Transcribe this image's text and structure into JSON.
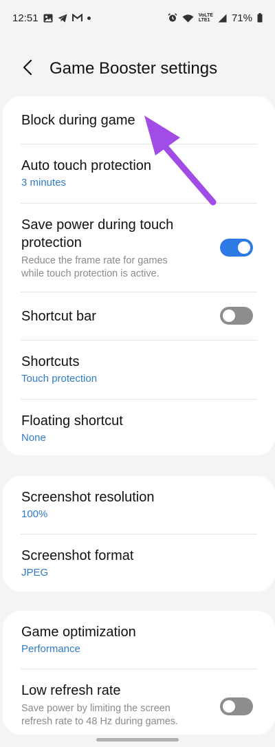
{
  "status_bar": {
    "time": "12:51",
    "battery": "71%",
    "lte_top": "VoLTE",
    "lte_bottom": "LTE1"
  },
  "header": {
    "title": "Game Booster settings"
  },
  "settings": {
    "block_during_game": {
      "title": "Block during game"
    },
    "auto_touch_protection": {
      "title": "Auto touch protection",
      "value": "3 minutes"
    },
    "save_power": {
      "title_line1": "Save power during touch",
      "title_line2": "protection",
      "desc_line1": "Reduce the frame rate for games",
      "desc_line2": "while touch protection is active.",
      "enabled": true
    },
    "shortcut_bar": {
      "title": "Shortcut bar",
      "enabled": false
    },
    "shortcuts": {
      "title": "Shortcuts",
      "value": "Touch protection"
    },
    "floating_shortcut": {
      "title": "Floating shortcut",
      "value": "None"
    },
    "screenshot_resolution": {
      "title": "Screenshot resolution",
      "value": "100%"
    },
    "screenshot_format": {
      "title": "Screenshot format",
      "value": "JPEG"
    },
    "game_optimization": {
      "title": "Game optimization",
      "value": "Performance"
    },
    "low_refresh_rate": {
      "title": "Low refresh rate",
      "desc_line1": "Save power by limiting the screen",
      "desc_line2": "refresh rate to 48 Hz during games.",
      "enabled": false
    }
  },
  "colors": {
    "accent": "#2c7be5",
    "link_blue": "#2f7bc5",
    "annotation_arrow": "#a24ce6",
    "background": "#f4f4f6"
  },
  "icons": {
    "back": "back-arrow-icon",
    "status": [
      "gallery-icon",
      "telegram-icon",
      "gmail-icon",
      "notification-dot-icon",
      "alarm-icon",
      "wifi-icon",
      "signal-icon",
      "battery-icon"
    ]
  }
}
